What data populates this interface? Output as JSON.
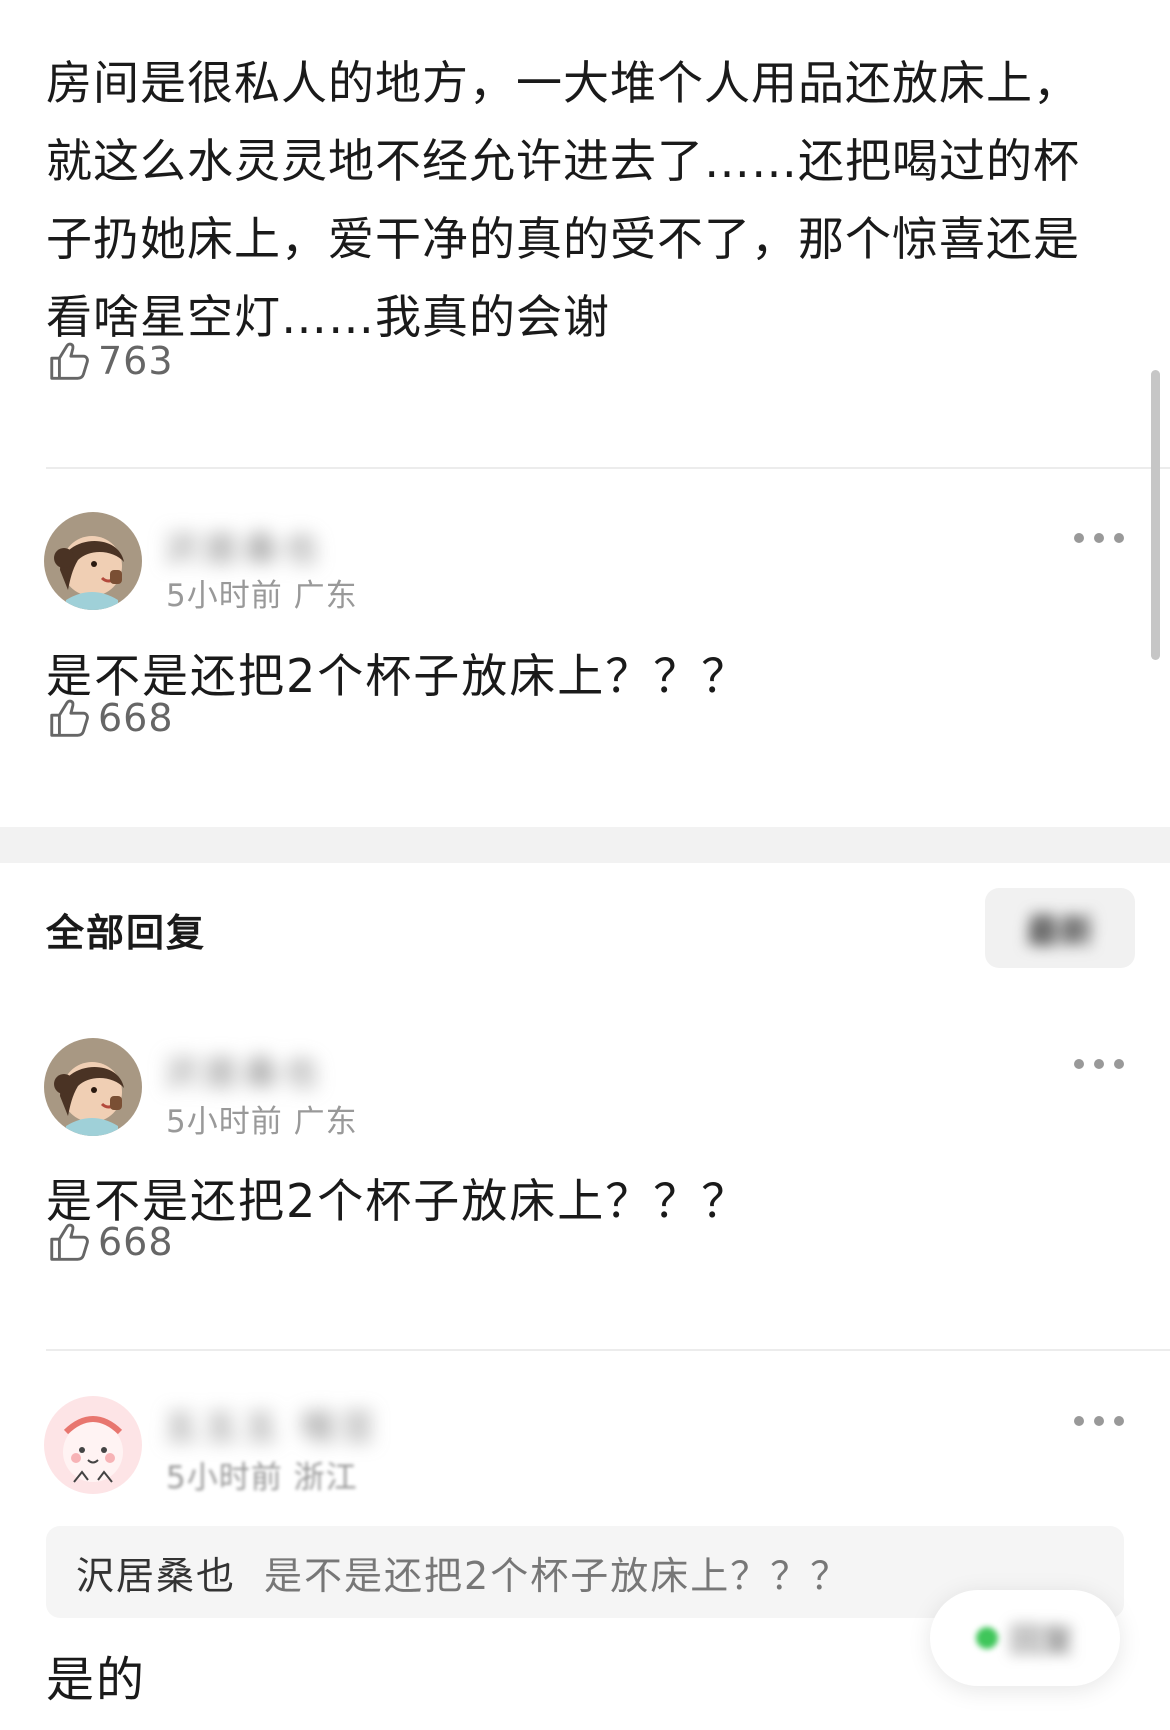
{
  "top_comment": {
    "lines": [
      "房间是很私人的地方，一大堆个人用品还放床上，",
      "就这么水灵灵地不经允许进去了……还把喝过的杯",
      "子扔她床上，爱干净的真的受不了，那个惊喜还是",
      "看啥星空灯……我真的会谢"
    ],
    "likes": "763"
  },
  "main_comment": {
    "username": "沢居桑也",
    "meta": "5小时前 广东",
    "text": "是不是还把2个杯子放床上？？？",
    "likes": "668"
  },
  "replies_section": {
    "title": "全部回复",
    "sort_label": "最新"
  },
  "replies": [
    {
      "username": "沢居桑也",
      "meta": "5小时前 广东",
      "text": "是不是还把2个杯子放床上？？？",
      "likes": "668"
    },
    {
      "username": "五五五 哦豆",
      "meta": "5小时前 浙江",
      "quote_author": "沢居桑也",
      "quote_text": "是不是还把2个杯子放床上？？？",
      "text": "是的"
    }
  ],
  "floating_button": {
    "label": "回复"
  },
  "colors": {
    "divider": "#ececec",
    "band": "#f2f2f2",
    "meta": "#999999"
  },
  "icons": [
    "thumbs-up-icon",
    "more-dots-icon",
    "avatar-girl",
    "avatar-cartoon"
  ]
}
